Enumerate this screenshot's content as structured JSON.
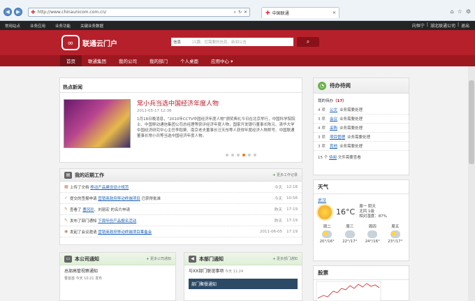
{
  "browser": {
    "url": "http://www.chinaunicom.com.cn/",
    "tab_title": "中国联通",
    "nav_back": "◀",
    "nav_fwd": "▶"
  },
  "topbar": {
    "links": [
      "常用站点",
      "业务应用",
      "业务功能",
      "关键业务数据"
    ],
    "user": "向恒宁",
    "sep": "|",
    "company": "湖北联通公司",
    "logout": "退出"
  },
  "header": {
    "logo_text": "联通云门户",
    "search_select": "信息",
    "search_placeholder": "搜索您感兴趣、您需要的信息、新闻公告"
  },
  "mainnav": [
    "首页",
    "联通集团",
    "我的公司",
    "我的部门",
    "个人桌面",
    "应用中心 ▾"
  ],
  "news": {
    "section_title": "热点新闻",
    "headline": "常小兵当选中国经济年度人物",
    "date": "2011-05-17 12:36",
    "body": "1月18日晚消息，“2010年CCTV中国经济年度人物”颁奖典礼今日在北京举行，中国科学院院士、中国移动通信集团公司总经理等获评经济年度人物，国家开发银行董事长陈元、清华大学中国经济研究中心主任李稻葵、南京老夫董事长汪天彤等人获得年度经济人物称号、中国联通董事长常小兵等当选中国经济年度人物。"
  },
  "work": {
    "title": "我的近期工作",
    "more": "更多工作记录",
    "rows": [
      {
        "pre": "上传了文档",
        "link": "移动产品建设设计规范",
        "post": "",
        "date": "今天",
        "time": "12:18"
      },
      {
        "pre": "提交的签报申请",
        "link": "营销商政府移动终端项目",
        "post": "已获得批准",
        "date": "今天",
        "time": "10:56"
      },
      {
        "pre": "查看了",
        "link": "曹风珍",
        "post": "、刘丽宏 的名片申请",
        "date": "昨天",
        "time": "17:19"
      },
      {
        "pre": "发布了部门通知",
        "link": "下周年份产品报名活动",
        "post": "",
        "date": "昨天",
        "time": "17:19"
      },
      {
        "pre": "发起了会议邀请",
        "link": "营销商政府移动终端项目筹备会",
        "post": "",
        "date": "2011-06-05",
        "time": "17:19"
      }
    ]
  },
  "todo": {
    "title": "待办待阅",
    "sub_label": "我的待办",
    "sub_count": "（17）",
    "rows": [
      {
        "n": "4 项",
        "link": "公文",
        "desc": "业务需要处理"
      },
      {
        "n": "3 项",
        "link": "会议",
        "desc": "业务需要处理"
      },
      {
        "n": "4 项",
        "link": "采购",
        "desc": "业务需要处理"
      },
      {
        "n": "3 项",
        "link": "项目管理",
        "desc": "业务需要处理"
      },
      {
        "n": "3 项",
        "link": "其他",
        "desc": "业务需要处理"
      }
    ],
    "foot_n": "15 个",
    "foot_link": "待阅",
    "foot_desc": "文件需要查看"
  },
  "weather": {
    "title": "天气",
    "city": "武汉",
    "temp": "16°C",
    "info1": "周一  阴天",
    "info2": "北风 1级",
    "info3": "相对湿度：87%",
    "days": [
      {
        "name": "周二",
        "range": "20°/16°",
        "icon": "partly-cloudy"
      },
      {
        "name": "周三",
        "range": "22°/17°",
        "icon": "cloudy"
      },
      {
        "name": "周四",
        "range": "24°/16°",
        "icon": "cloudy"
      },
      {
        "name": "周五",
        "range": "23°/17°",
        "icon": "partly-cloudy"
      }
    ]
  },
  "stock": {
    "title": "股票"
  },
  "company_notice": {
    "title": "本公司通知",
    "more": "更多公司通知",
    "item": "总部高管视察通知",
    "meta": "曹苗苗   今天  10:21  发布"
  },
  "dept_notice": {
    "title": "本部门通知",
    "more": "更多部门通知",
    "item1": "与XX部门联谊事项",
    "meta1": "今天  11:24",
    "item2": "部门聚餐通知"
  }
}
